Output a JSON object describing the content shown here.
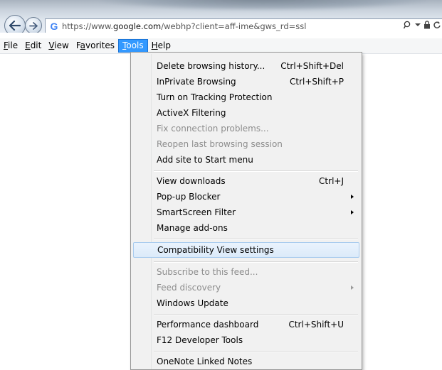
{
  "address_bar": {
    "url_scheme": "https://www.",
    "url_domain": "google.com",
    "url_rest": "/webhp?client=aff-ime&gws_rd=ssl",
    "favicon": "G"
  },
  "icons": {
    "back": "back-arrow-icon",
    "forward": "forward-arrow-icon",
    "search": "search-icon",
    "lock": "lock-icon",
    "refresh": "refresh-icon"
  },
  "menubar": {
    "items": [
      {
        "pre": "",
        "key": "F",
        "post": "ile"
      },
      {
        "pre": "",
        "key": "E",
        "post": "dit"
      },
      {
        "pre": "",
        "key": "V",
        "post": "iew"
      },
      {
        "pre": "F",
        "key": "a",
        "post": "vorites"
      },
      {
        "pre": "",
        "key": "T",
        "post": "ools"
      },
      {
        "pre": "",
        "key": "H",
        "post": "elp"
      }
    ],
    "active_index": 4
  },
  "tools_menu": {
    "items": [
      {
        "label": "Delete browsing history...",
        "shortcut": "Ctrl+Shift+Del"
      },
      {
        "label": "InPrivate Browsing",
        "shortcut": "Ctrl+Shift+P"
      },
      {
        "label": "Turn on Tracking Protection",
        "shortcut": ""
      },
      {
        "label": "ActiveX Filtering",
        "shortcut": ""
      },
      {
        "label": "Fix connection problems...",
        "shortcut": ""
      },
      {
        "label": "Reopen last browsing session",
        "shortcut": ""
      },
      {
        "label": "Add site to Start menu",
        "shortcut": ""
      },
      {
        "label": "View downloads",
        "shortcut": "Ctrl+J"
      },
      {
        "label": "Pop-up Blocker",
        "shortcut": ""
      },
      {
        "label": "SmartScreen Filter",
        "shortcut": ""
      },
      {
        "label": "Manage add-ons",
        "shortcut": ""
      },
      {
        "label": "Compatibility View settings",
        "shortcut": ""
      },
      {
        "label": "Subscribe to this feed...",
        "shortcut": ""
      },
      {
        "label": "Feed discovery",
        "shortcut": ""
      },
      {
        "label": "Windows Update",
        "shortcut": ""
      },
      {
        "label": "Performance dashboard",
        "shortcut": "Ctrl+Shift+U"
      },
      {
        "label": "F12 Developer Tools",
        "shortcut": ""
      },
      {
        "label": "OneNote Linked Notes",
        "shortcut": ""
      }
    ]
  },
  "colors": {
    "menu_active": "#3399ff",
    "menu_highlight_border": "#a8cbee",
    "disabled_text": "#8d8d8d"
  }
}
